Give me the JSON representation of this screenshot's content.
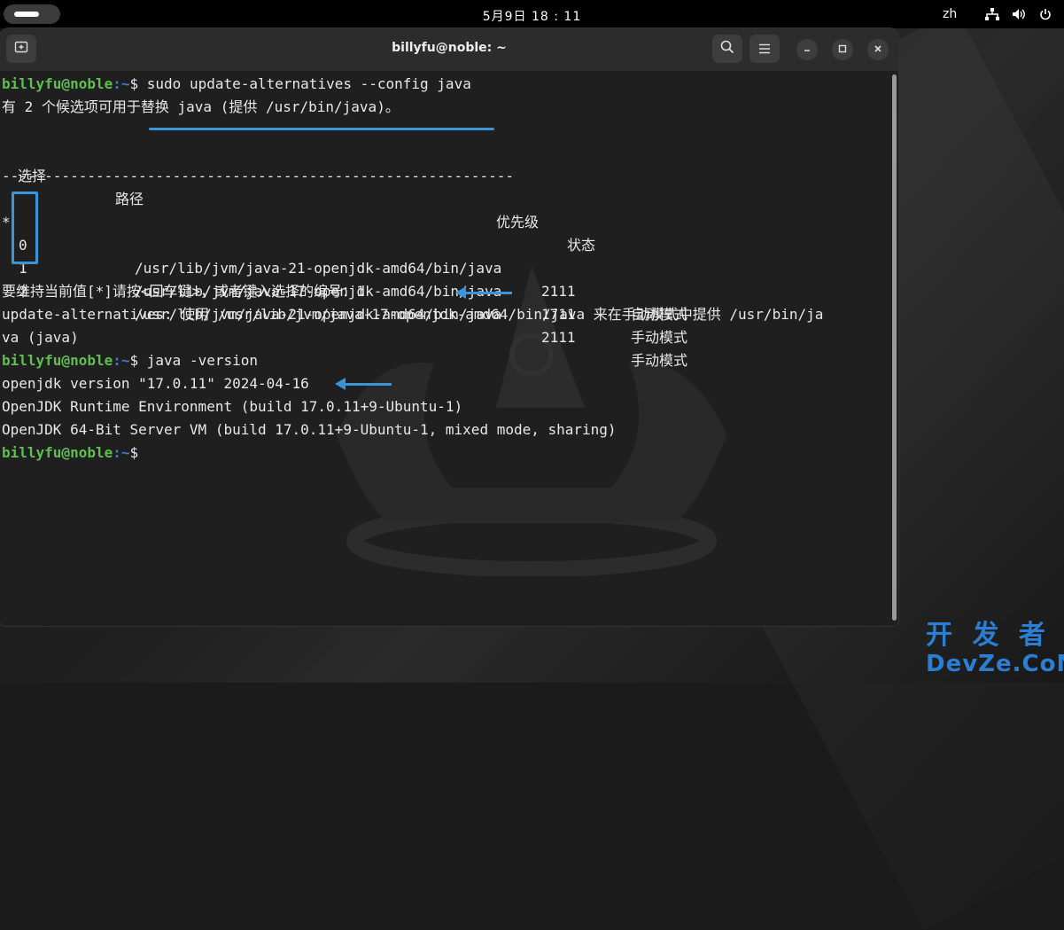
{
  "topbar": {
    "clock": "5月9日  18 : 11",
    "input_language": "zh",
    "tray_icons": [
      "network-icon",
      "volume-icon",
      "power-icon"
    ]
  },
  "window": {
    "title": "billyfu@noble: ~",
    "buttons": [
      "new-tab-icon",
      "search-icon",
      "menu-icon",
      "minimize-icon",
      "maximize-icon",
      "close-icon"
    ]
  },
  "terminal": {
    "prompt_user": "billyfu@noble",
    "prompt_path": ":~",
    "prompt_symbol": "$",
    "cmd1": "sudo update-alternatives --config java",
    "line_candidates": "有 2 个候选项可用于替换 java (提供 /usr/bin/java)。",
    "header_select": "选择",
    "header_path": "路径",
    "header_priority": "优先级",
    "header_status": "状态",
    "separator": "------------------------------------------------------------",
    "rows": [
      {
        "marker": "*",
        "select": "0",
        "path": "/usr/lib/jvm/java-21-openjdk-amd64/bin/java",
        "priority": "2111",
        "status": "自动模式"
      },
      {
        "marker": "",
        "select": "1",
        "path": "/usr/lib/jvm/java-17-openjdk-amd64/bin/java",
        "priority": "1711",
        "status": "手动模式"
      },
      {
        "marker": "",
        "select": "2",
        "path": "/usr/lib/jvm/java-21-openjdk-amd64/bin/java",
        "priority": "2111",
        "status": "手动模式"
      }
    ],
    "choice_prompt": "要维持当前值[*]请按<回车键>，或者键入选择的编号：1",
    "update_line1": "update-alternatives: 使用 /usr/lib/jvm/java-17-openjdk-amd64/bin/java 来在手动模式中提供 /usr/bin/ja",
    "update_line2": "va (java)",
    "cmd2": "java -version",
    "version_line1": "openjdk version \"17.0.11\" 2024-04-16",
    "version_line2": "OpenJDK Runtime Environment (build 17.0.11+9-Ubuntu-1)",
    "version_line3": "OpenJDK 64-Bit Server VM (build 17.0.11+9-Ubuntu-1, mixed mode, sharing)"
  },
  "watermark": {
    "line1": "开 发 者",
    "line2": "DevZe.CoM"
  },
  "colors": {
    "prompt_user": "#5fbf4f",
    "prompt_path": "#3a7bd5",
    "annotation": "#3a95d8",
    "brand": "#2a7fd4"
  }
}
